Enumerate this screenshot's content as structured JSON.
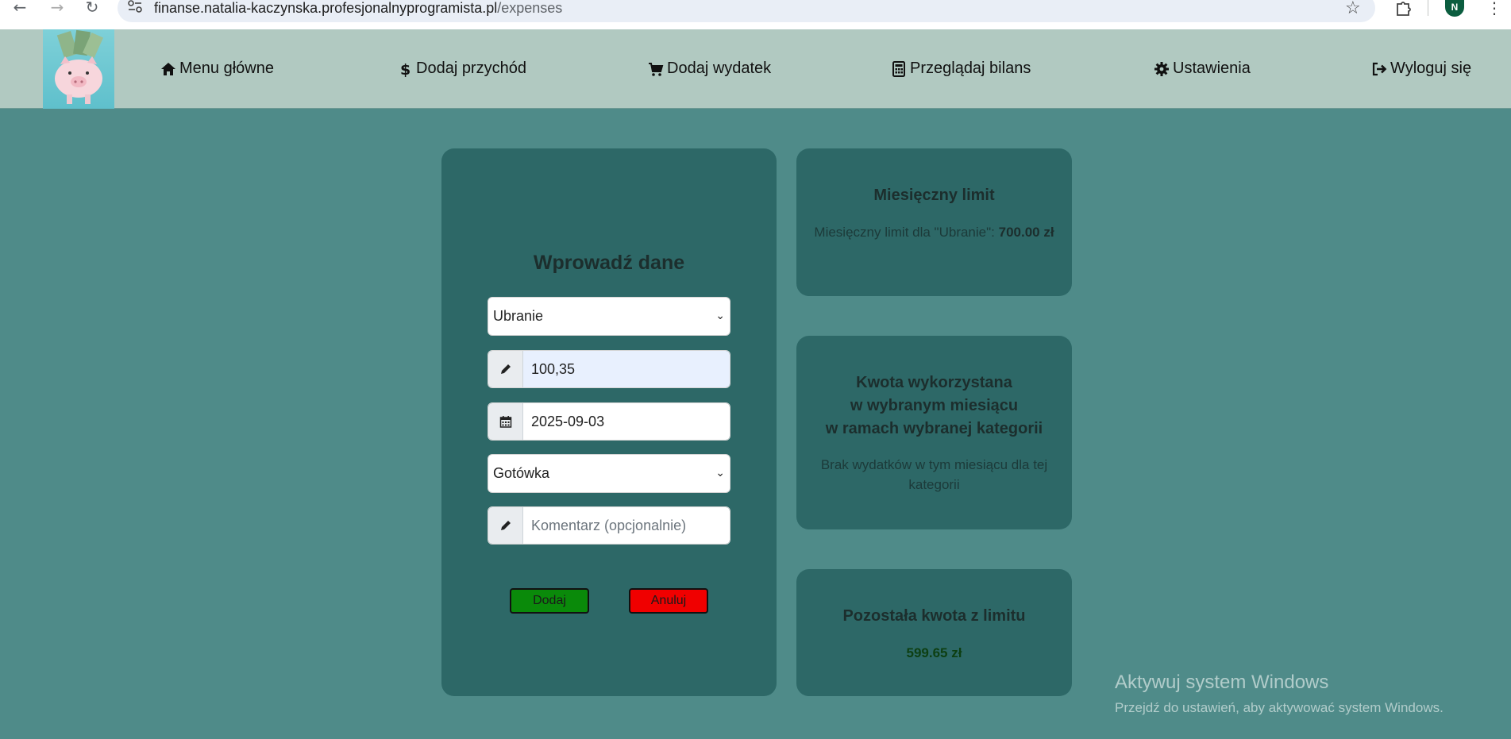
{
  "browser": {
    "url_host": "finanse.natalia-kaczynska.profesjonalnyprogramista.pl",
    "url_path": "/expenses",
    "profile_initial": "N"
  },
  "nav": {
    "items": [
      {
        "label": "Menu główne",
        "icon": "home-icon"
      },
      {
        "label": "Dodaj przychód",
        "icon": "dollar-icon"
      },
      {
        "label": "Dodaj wydatek",
        "icon": "cart-icon"
      },
      {
        "label": "Przeglądaj bilans",
        "icon": "calculator-icon"
      },
      {
        "label": "Ustawienia",
        "icon": "gear-icon"
      },
      {
        "label": "Wyloguj się",
        "icon": "logout-icon"
      }
    ]
  },
  "form": {
    "title": "Wprowadź dane",
    "category_value": "Ubranie",
    "amount_value": "100,35",
    "date_value": "2025-09-03",
    "payment_value": "Gotówka",
    "comment_placeholder": "Komentarz (opcjonalnie)",
    "add_label": "Dodaj",
    "cancel_label": "Anuluj"
  },
  "limit_card": {
    "title": "Miesięczny limit",
    "text_prefix": "Miesięczny limit dla \"Ubranie\": ",
    "limit_value": "700.00",
    "currency": "zł"
  },
  "used_card": {
    "title_line1": "Kwota wykorzystana",
    "title_line2": "w wybranym miesiącu",
    "title_line3": "w ramach wybranej kategorii",
    "text": "Brak wydatków w tym miesiącu dla tej kategorii"
  },
  "remaining_card": {
    "title": "Pozostała kwota z limitu",
    "value": "599.65 zł"
  },
  "watermark": {
    "line1": "Aktywuj system Windows",
    "line2": "Przejdź do ustawień, aby aktywować system Windows."
  },
  "colors": {
    "page_bg": "#4f8b89",
    "nav_bg": "#b1c9c1",
    "card_bg": "#2d6867",
    "add_button": "#0a8a0a",
    "cancel_button": "#f00000"
  }
}
